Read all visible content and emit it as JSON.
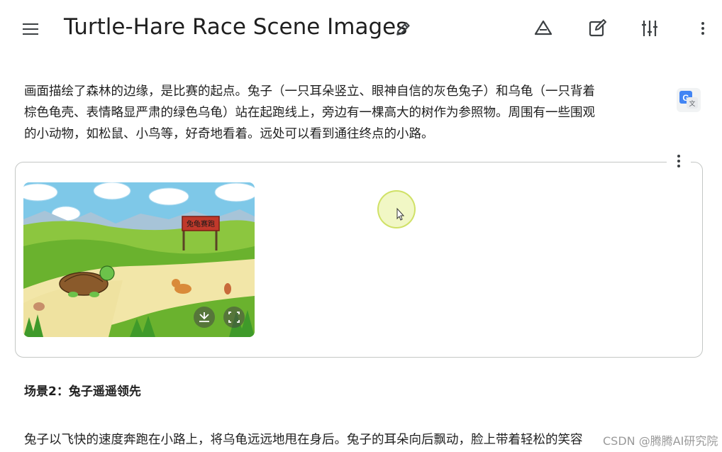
{
  "header": {
    "title": "Turtle-Hare Race Scene Images"
  },
  "toolbar": {
    "icons": [
      "drive-icon",
      "edit-note-icon",
      "tune-icon",
      "more-vert-icon"
    ]
  },
  "content": {
    "paragraph_lines": [
      "画面描绘了森林的边缘，是比赛的起点。兔子（一只耳朵竖立、眼神自信的灰色兔子）和乌龟（一只背着",
      "棕色龟壳、表情略显严肃的绿色乌龟）站在起跑线上，旁边有一棵高大的树作为参照物。周围有一些围观",
      "的小动物，如松鼠、小鸟等，好奇地看着。远处可以看到通往终点的小路。"
    ],
    "scene_sign_text": "兔龟赛跑",
    "heading2": "场景2：兔子遥遥领先",
    "paragraph2": "兔子以飞快的速度奔跑在小路上，将乌龟远远地甩在身后。兔子的耳朵向后飘动，脸上带着轻松的笑容"
  },
  "watermark": "CSDN @腾腾AI研究院",
  "colors": {
    "text": "#1f1f1f",
    "icon": "#3c4043",
    "border": "#c4c7c5"
  }
}
